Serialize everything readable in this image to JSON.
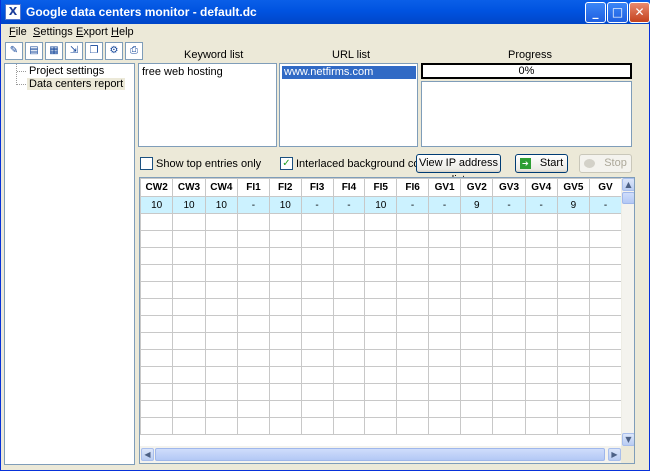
{
  "window": {
    "title": "Google data centers monitor - default.dc",
    "app_icon": "X"
  },
  "window_controls": {
    "minimize": "_",
    "maximize": "□",
    "close": "✕"
  },
  "menu": [
    "File",
    "Settings",
    "Export",
    "Help"
  ],
  "toolbar_icons": [
    "new-project-icon",
    "open-icon",
    "save-icon",
    "export-excel-icon",
    "copy-icon",
    "settings-icon",
    "print-icon"
  ],
  "tree": {
    "items": [
      "Project settings",
      "Data centers report"
    ],
    "selected": 1
  },
  "keyword_list": {
    "label": "Keyword list",
    "items": [
      "free web hosting"
    ]
  },
  "url_list": {
    "label": "URL list",
    "items": [
      "www.netfirms.com"
    ]
  },
  "progress": {
    "label": "Progress",
    "value_text": "0%",
    "value": 0
  },
  "options": {
    "show_top_entries_label": "Show top entries only",
    "show_top_entries_checked": false,
    "interlaced_label": "Interlaced background color",
    "interlaced_checked": true
  },
  "buttons": {
    "view_ip": "View IP address list",
    "start": "Start",
    "stop": "Stop"
  },
  "grid": {
    "columns": [
      "CW2",
      "CW3",
      "CW4",
      "FI1",
      "FI2",
      "FI3",
      "FI4",
      "FI5",
      "FI6",
      "GV1",
      "GV2",
      "GV3",
      "GV4",
      "GV5",
      "GV"
    ],
    "rows": [
      [
        "10",
        "10",
        "10",
        "-",
        "10",
        "-",
        "-",
        "10",
        "-",
        "-",
        "9",
        "-",
        "-",
        "9",
        "-"
      ]
    ]
  },
  "scroll_glyphs": {
    "up": "▲",
    "down": "▼",
    "left": "◀",
    "right": "▶"
  }
}
